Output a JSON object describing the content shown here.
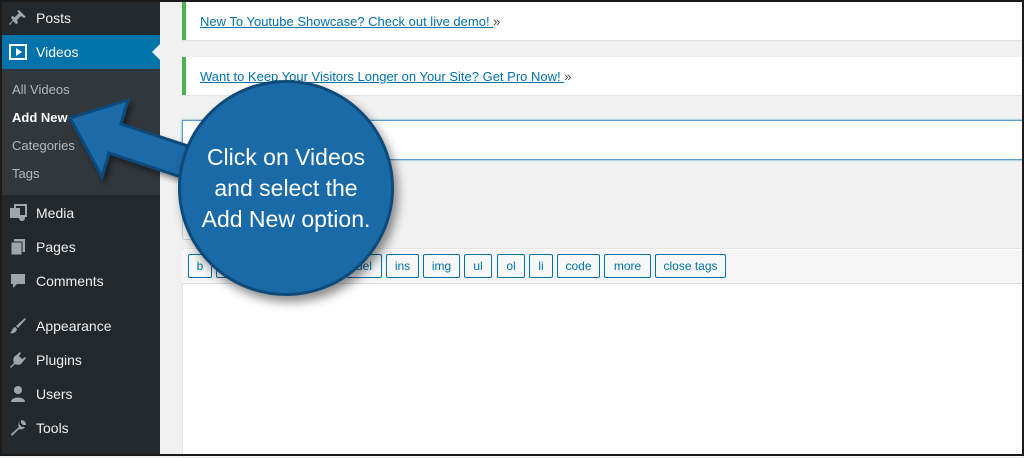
{
  "sidebar": {
    "items": [
      {
        "label": "Posts",
        "icon": "pin-icon"
      },
      {
        "label": "Videos",
        "icon": "video-icon",
        "active": true
      },
      {
        "label": "Media",
        "icon": "media-icon"
      },
      {
        "label": "Pages",
        "icon": "pages-icon"
      },
      {
        "label": "Comments",
        "icon": "comment-icon"
      },
      {
        "label": "Appearance",
        "icon": "brush-icon"
      },
      {
        "label": "Plugins",
        "icon": "plug-icon"
      },
      {
        "label": "Users",
        "icon": "user-icon"
      },
      {
        "label": "Tools",
        "icon": "wrench-icon"
      }
    ],
    "submenu": [
      "All Videos",
      "Add New",
      "Categories",
      "Tags"
    ],
    "current_submenu": "Add New"
  },
  "notices": [
    {
      "link": "New To Youtube Showcase? Check out live demo! ",
      "suffix": "»"
    },
    {
      "link": "Want to Keep Your Visitors Longer on Your Site? Get Pro Now! ",
      "suffix": "»"
    }
  ],
  "editor": {
    "quicktags": [
      "b",
      "",
      "",
      "",
      "del",
      "ins",
      "img",
      "ul",
      "ol",
      "li",
      "code",
      "more",
      "close tags"
    ]
  },
  "callout": {
    "text": "Click on Videos and select the Add New option."
  },
  "colors": {
    "sidebar_bg": "#23282d",
    "active_bg": "#0073aa",
    "accent": "#0073aa",
    "notice_border": "#46b450",
    "callout_bg": "#1a6aa8"
  }
}
